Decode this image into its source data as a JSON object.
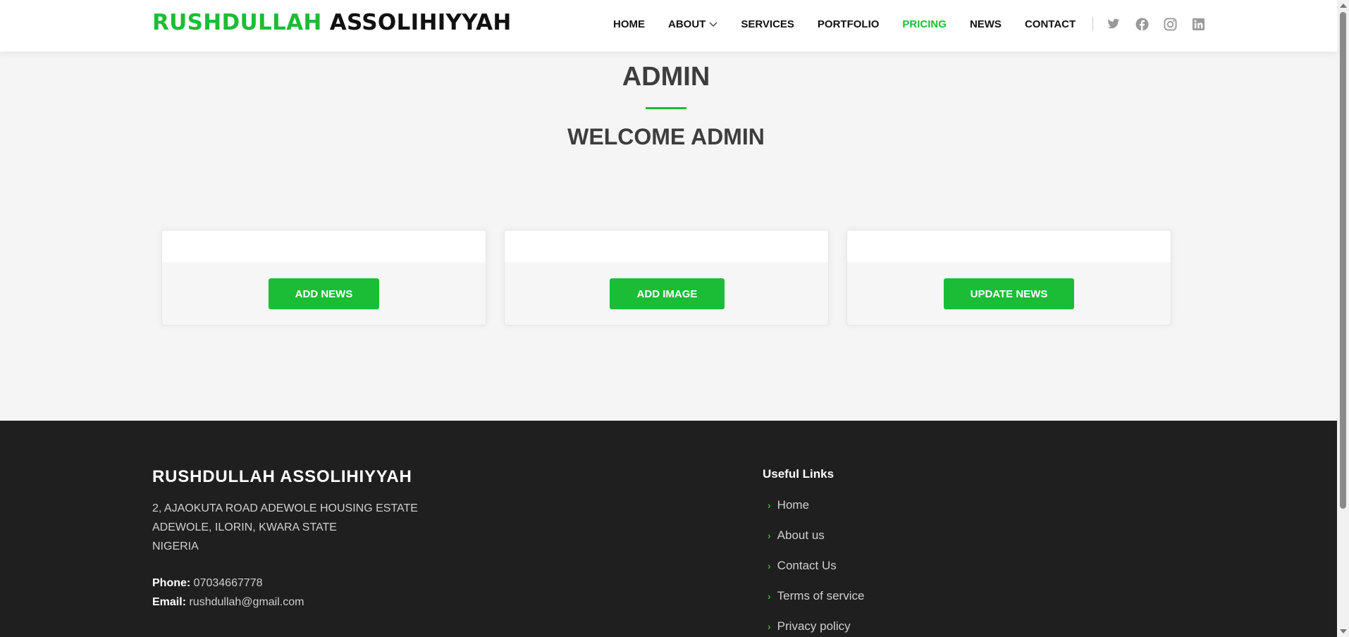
{
  "header": {
    "logo_green": "RUSHDULLAH",
    "logo_dark": "ASSOLIHIYYAH",
    "nav": [
      {
        "label": "HOME"
      },
      {
        "label": "ABOUT"
      },
      {
        "label": "SERVICES"
      },
      {
        "label": "PORTFOLIO"
      },
      {
        "label": "PRICING"
      },
      {
        "label": "NEWS"
      },
      {
        "label": "CONTACT"
      }
    ],
    "active_nav": "PRICING",
    "social_icons": [
      "twitter-icon",
      "facebook-icon",
      "instagram-icon",
      "linkedin-icon"
    ]
  },
  "main": {
    "title": "ADMIN",
    "welcome": "WELCOME ADMIN",
    "cards": [
      {
        "button": "ADD NEWS"
      },
      {
        "button": "ADD IMAGE"
      },
      {
        "button": "UPDATE NEWS"
      }
    ]
  },
  "footer": {
    "brand": "RUSHDULLAH ASSOLIHIYYAH",
    "address_lines": [
      "2, AJAOKUTA ROAD ADEWOLE HOUSING ESTATE",
      "ADEWOLE, ILORIN, KWARA STATE",
      "NIGERIA"
    ],
    "phone_label": "Phone:",
    "phone": "07034667778",
    "email_label": "Email:",
    "email": "rushdullah@gmail.com",
    "links_title": "Useful Links",
    "links": [
      "Home",
      "About us",
      "Contact Us",
      "Terms of service",
      "Privacy policy"
    ]
  },
  "colors": {
    "accent": "#1bbd36",
    "footer_bg": "#1f1f1f",
    "page_bg": "#f5f5f5"
  }
}
